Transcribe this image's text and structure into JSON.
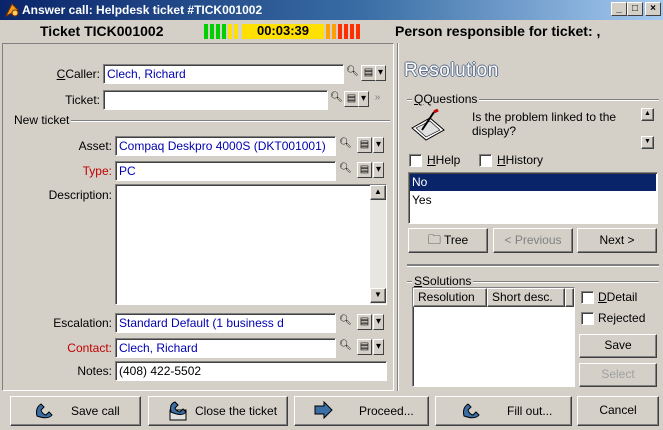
{
  "window": {
    "title": "Answer call: Helpdesk ticket #TICK001002",
    "min": "_",
    "max": "□",
    "close": "×"
  },
  "header": {
    "ticket": "Ticket TICK001002",
    "timer": "00:03:39",
    "responsible": "Person responsible for ticket: ,"
  },
  "form": {
    "caller_label": "Caller:",
    "caller_value": "Clech, Richard",
    "ticket_label": "Ticket:",
    "ticket_value": "",
    "new_ticket_group": "New ticket",
    "asset_label": "Asset:",
    "asset_value": "Compaq Deskpro 4000S (DKT001001)",
    "type_label": "Type:",
    "type_value": "PC",
    "description_label": "Description:",
    "description_value": "",
    "escalation_label": "Escalation:",
    "escalation_value": "Standard Default (1 business d",
    "contact_label": "Contact:",
    "contact_value": "Clech, Richard",
    "notes_label": "Notes:",
    "notes_value": "(408) 422-5502"
  },
  "resolution": {
    "title": "Resolution",
    "questions_group": "Questions",
    "question_text": "Is the problem linked to the display?",
    "help_label": "Help",
    "history_label": "History",
    "answers": [
      "No",
      "Yes"
    ],
    "selected_answer": "No",
    "tree_button": "Tree",
    "previous_button": "< Previous",
    "next_button": "Next >",
    "solutions_group": "Solutions",
    "columns": [
      "Resolution",
      "Short desc."
    ],
    "detail_label": "Detail",
    "rejected_label": "Rejected",
    "save_button": "Save",
    "select_button": "Select"
  },
  "footer": {
    "save_call": "Save call",
    "close_ticket": "Close the ticket",
    "proceed": "Proceed...",
    "fill_out": "Fill out...",
    "cancel": "Cancel"
  },
  "colors": {
    "title_start": "#0a246a",
    "title_end": "#a6caf0",
    "link_blue": "#0000b0",
    "required_red": "#c00000",
    "selected_row": "#0a246a",
    "timer_green": "#00d000",
    "timer_yellow": "#ffe000",
    "timer_red": "#ff3000"
  }
}
